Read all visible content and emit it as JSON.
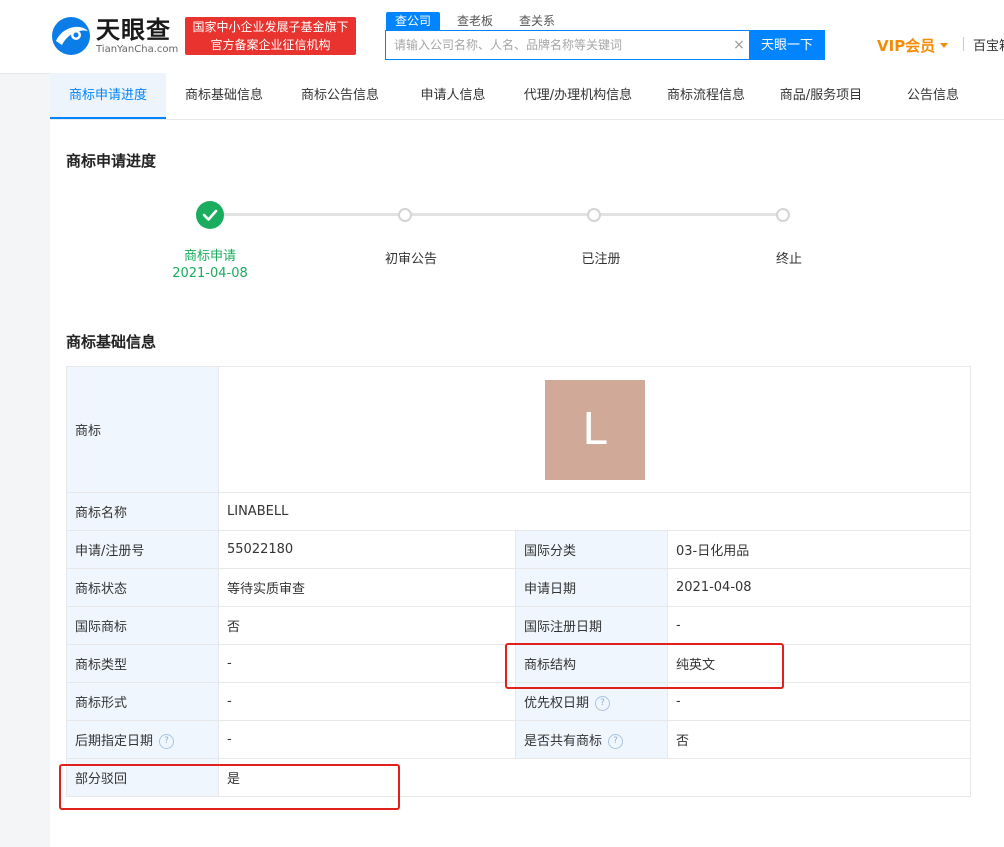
{
  "header": {
    "logo_cn": "天眼查",
    "logo_en": "TianYanCha.com",
    "badge_line1": "国家中小企业发展子基金旗下",
    "badge_line2": "官方备案企业征信机构",
    "search_tabs": [
      "查公司",
      "查老板",
      "查关系"
    ],
    "search_placeholder": "请输入公司名称、人名、品牌名称等关键词",
    "clear": "×",
    "search_button": "天眼一下",
    "vip": "VIP会员",
    "baibao": "百宝箱"
  },
  "tabs": [
    "商标申请进度",
    "商标基础信息",
    "商标公告信息",
    "申请人信息",
    "代理/办理机构信息",
    "商标流程信息",
    "商品/服务项目",
    "公告信息"
  ],
  "progress": {
    "title": "商标申请进度",
    "steps": [
      {
        "label": "商标申请",
        "date": "2021-04-08"
      },
      {
        "label": "初审公告",
        "date": ""
      },
      {
        "label": "已注册",
        "date": ""
      },
      {
        "label": "终止",
        "date": ""
      }
    ]
  },
  "basic": {
    "title": "商标基础信息",
    "mark_label": "商标",
    "mark_letter": "L",
    "name_label": "商标名称",
    "name_value": "LINABELL",
    "rows": [
      [
        "申请/注册号",
        "55022180",
        "国际分类",
        "03-日化用品"
      ],
      [
        "商标状态",
        "等待实质审查",
        "申请日期",
        "2021-04-08"
      ],
      [
        "国际商标",
        "否",
        "国际注册日期",
        "-"
      ],
      [
        "商标类型",
        "-",
        "商标结构",
        "纯英文"
      ],
      [
        "商标形式",
        "-",
        "优先权日期",
        "-"
      ],
      [
        "后期指定日期",
        "-",
        "是否共有商标",
        "否"
      ]
    ],
    "partial_label": "部分驳回",
    "partial_value": "是",
    "help": "?"
  },
  "colors": {
    "accent": "#0084ff",
    "success": "#1aad5e",
    "highlight": "#e0211b",
    "vip": "#f48c06"
  }
}
